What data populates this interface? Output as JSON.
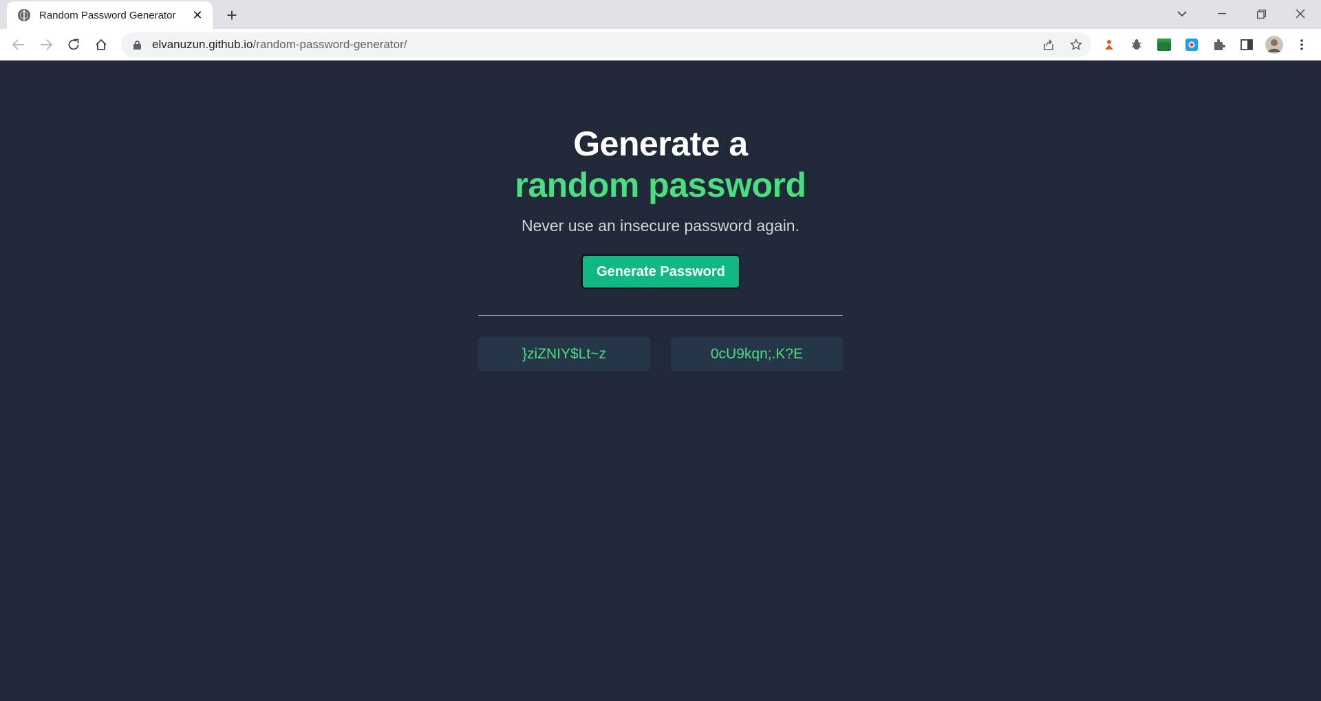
{
  "browser": {
    "tab": {
      "title": "Random Password Generator"
    },
    "url": {
      "domain": "elvanuzun.github.io",
      "path": "/random-password-generator/"
    }
  },
  "page": {
    "heading_line1": "Generate a",
    "heading_line2": "random password",
    "subtitle": "Never use an insecure password again.",
    "generate_button_label": "Generate Password",
    "passwords": [
      "}ziZNIY$Lt~z",
      "0cU9kqn;.K?E"
    ]
  },
  "colors": {
    "background": "#1f2937",
    "accent_green": "#4ade80",
    "button_green": "#10b981",
    "password_box": "#273549"
  }
}
